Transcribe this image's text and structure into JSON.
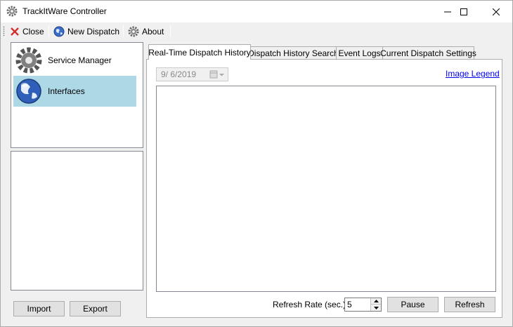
{
  "window": {
    "title": "TrackItWare Controller"
  },
  "toolbar": {
    "close_label": "Close",
    "new_dispatch_label": "New Dispatch",
    "about_label": "About"
  },
  "nav": {
    "items": [
      {
        "label": "Service Manager",
        "icon": "gear-icon",
        "selected": false
      },
      {
        "label": "Interfaces",
        "icon": "globe-icon",
        "selected": true
      }
    ]
  },
  "left_buttons": {
    "import_label": "Import",
    "export_label": "Export"
  },
  "tabs": [
    {
      "label": "Real-Time Dispatch History",
      "active": true
    },
    {
      "label": "Dispatch History Search",
      "active": false
    },
    {
      "label": "Event Logs",
      "active": false
    },
    {
      "label": "Current Dispatch Settings",
      "active": false
    }
  ],
  "history": {
    "date_value": "9/  6/2019",
    "image_legend_label": "Image Legend",
    "refresh_rate_label": "Refresh Rate (sec.):",
    "refresh_rate_value": "5",
    "pause_label": "Pause",
    "refresh_label": "Refresh"
  },
  "colors": {
    "selected_nav": "#add8e6",
    "link": "#0000ee",
    "close_x": "#d0302f"
  }
}
